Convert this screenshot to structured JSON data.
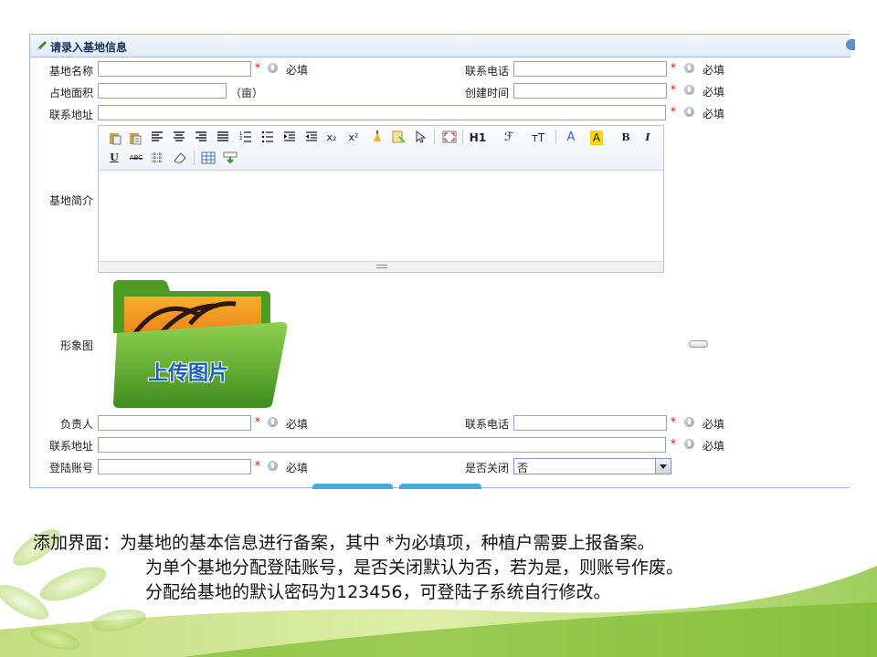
{
  "form": {
    "title": "请录入基地信息",
    "required_mark": "*",
    "must_text": "必填",
    "fields": {
      "base_name": {
        "label": "基地名称",
        "value": ""
      },
      "contact_phone": {
        "label": "联系电话",
        "value": ""
      },
      "area": {
        "label": "占地面积",
        "value": "",
        "unit": "（亩）"
      },
      "created_time": {
        "label": "创建时间",
        "value": ""
      },
      "contact_address": {
        "label": "联系地址",
        "value": ""
      },
      "intro": {
        "label": "基地简介",
        "value": ""
      },
      "image": {
        "label": "形象图",
        "upload_text": "上传图片"
      },
      "manager": {
        "label": "负责人",
        "value": ""
      },
      "manager_phone": {
        "label": "联系电话",
        "value": ""
      },
      "manager_address": {
        "label": "联系地址",
        "value": ""
      },
      "login_account": {
        "label": "登陆账号",
        "value": ""
      },
      "closed": {
        "label": "是否关闭",
        "value": "否"
      }
    }
  },
  "editor": {
    "toolbar_row1": [
      "paste-icon",
      "paste-text-icon",
      "align-left-icon",
      "align-center-icon",
      "align-right-icon",
      "align-justify-icon",
      "ordered-list-icon",
      "unordered-list-icon",
      "indent-icon",
      "outdent-icon",
      "subscript-icon",
      "superscript-icon",
      "clear-format-icon",
      "select-all-icon",
      "select-icon",
      "fullscreen-icon",
      "heading-icon",
      "font-family-icon",
      "font-size-icon",
      "font-color-icon",
      "highlight-icon",
      "bold-icon",
      "italic-icon"
    ],
    "toolbar_row2": [
      "underline-icon",
      "strikethrough-icon",
      "horizontal-rule-icon",
      "eraser-icon",
      "table-icon",
      "insert-icon"
    ],
    "labels": {
      "subscript": "x₂",
      "superscript": "x²",
      "heading": "H1",
      "font_family": "ℱ",
      "font_size": "ᴛT",
      "font_color": "A",
      "highlight": "A",
      "bold": "B",
      "italic": "I",
      "underline": "U",
      "strike": "ABC"
    }
  },
  "description": {
    "line1": "添加界面：为基地的基本信息进行备案，其中 *为必填项，种植户需要上报备案。",
    "line2": "为单个基地分配登陆账号，是否关闭默认为否，若为是，则账号作废。",
    "line3": "分配给基地的默认密码为123456，可登陆子系统自行修改。"
  },
  "colors": {
    "required": "#e00000",
    "panel_border": "#9cb7d6",
    "upload_green": "#5fae2e"
  }
}
